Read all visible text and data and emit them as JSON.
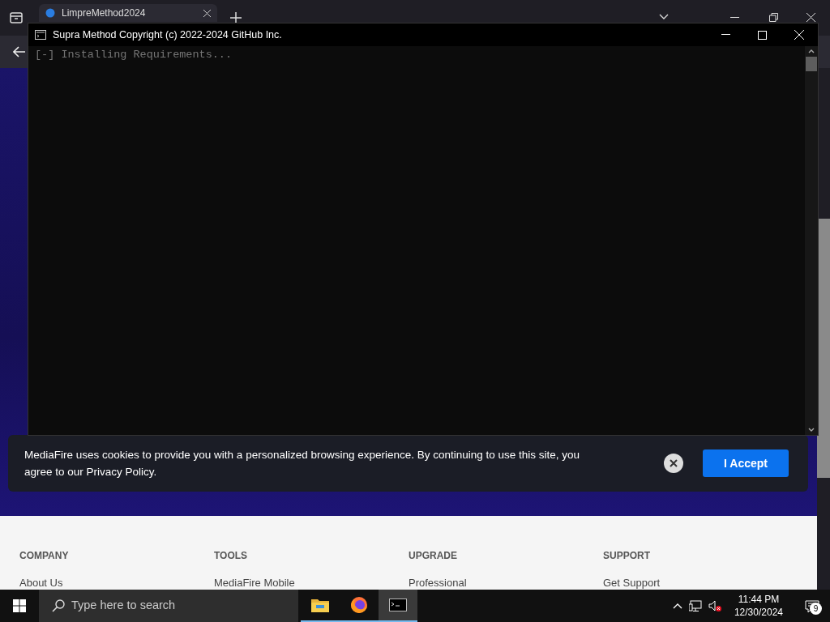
{
  "browser": {
    "tabs": [
      {
        "title": "LimpreMethod2024",
        "selected": true
      }
    ]
  },
  "console": {
    "title": "Supra Method Copyright (c) 2022-2024 GitHub Inc.",
    "lines": [
      "[-] Installing Requirements..."
    ]
  },
  "cookie_banner": {
    "message": "MediaFire uses cookies to provide you with a personalized browsing experience. By continuing to use this site, you agree to our Privacy Policy.",
    "accept": "I Accept"
  },
  "footer": {
    "columns": [
      {
        "heading": "COMPANY",
        "links": [
          "About Us"
        ]
      },
      {
        "heading": "TOOLS",
        "links": [
          "MediaFire Mobile"
        ]
      },
      {
        "heading": "UPGRADE",
        "links": [
          "Professional"
        ]
      },
      {
        "heading": "SUPPORT",
        "links": [
          "Get Support"
        ]
      }
    ]
  },
  "taskbar": {
    "search_placeholder": "Type here to search",
    "apps": [
      {
        "kind": "folder",
        "selected": false
      },
      {
        "kind": "firefox",
        "selected": false
      },
      {
        "kind": "terminal",
        "selected": true
      }
    ],
    "time": "11:44 PM",
    "date": "12/30/2024",
    "notifications": "9"
  }
}
